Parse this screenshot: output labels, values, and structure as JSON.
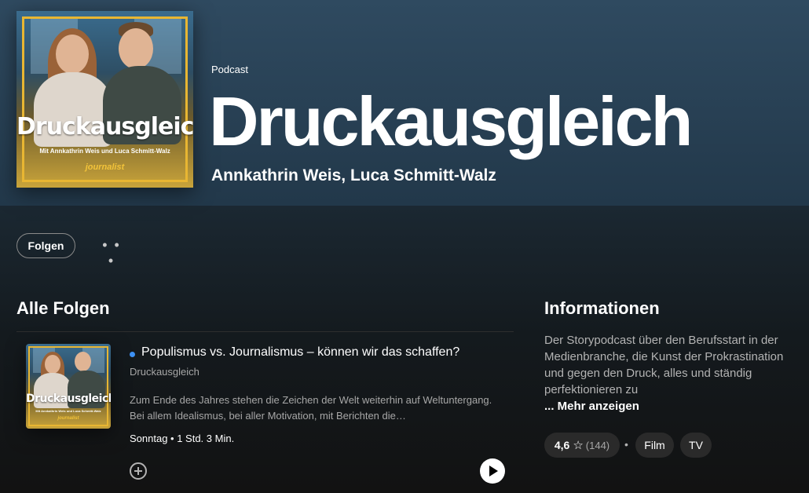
{
  "header": {
    "type_label": "Podcast",
    "title": "Druckausgleich",
    "authors": "Annkathrin Weis, Luca Schmitt-Walz"
  },
  "cover": {
    "title": "Druckausgleich",
    "subtitle": "Mit Annkathrin Weis und Luca Schmitt-Walz",
    "brand": "journalist",
    "frame_color": "#e8b632"
  },
  "actions": {
    "follow_label": "Folgen",
    "more_label": "• • •"
  },
  "episodes_section": {
    "title": "Alle Folgen",
    "items": [
      {
        "title": "Populismus vs. Journalismus – können wir das schaffen?",
        "show": "Druckausgleich",
        "description": "Zum Ende des Jahres stehen die Zeichen der Welt weiterhin auf Weltuntergang. Bei allem Idealismus, bei aller Motivation, mit Berichten die…",
        "date": "Sonntag",
        "duration": "1 Std. 3 Min.",
        "meta": "Sonntag • 1 Std. 3 Min.",
        "unplayed_color": "#3d91f4"
      }
    ]
  },
  "info_section": {
    "title": "Informationen",
    "description": "Der Storypodcast über den Berufsstart in der Medienbranche, die Kunst der Prokrastination und gegen den Druck, alles und ständig perfektionieren zu",
    "more_label": "... Mehr anzeigen",
    "rating": {
      "value": "4,6",
      "star": "☆",
      "count": "(144)"
    },
    "separator": "•",
    "categories": [
      "Film",
      "TV"
    ]
  },
  "colors": {
    "hero_bg": "#2f4a60",
    "page_bg": "#121212",
    "accent_blue": "#3d91f4"
  }
}
